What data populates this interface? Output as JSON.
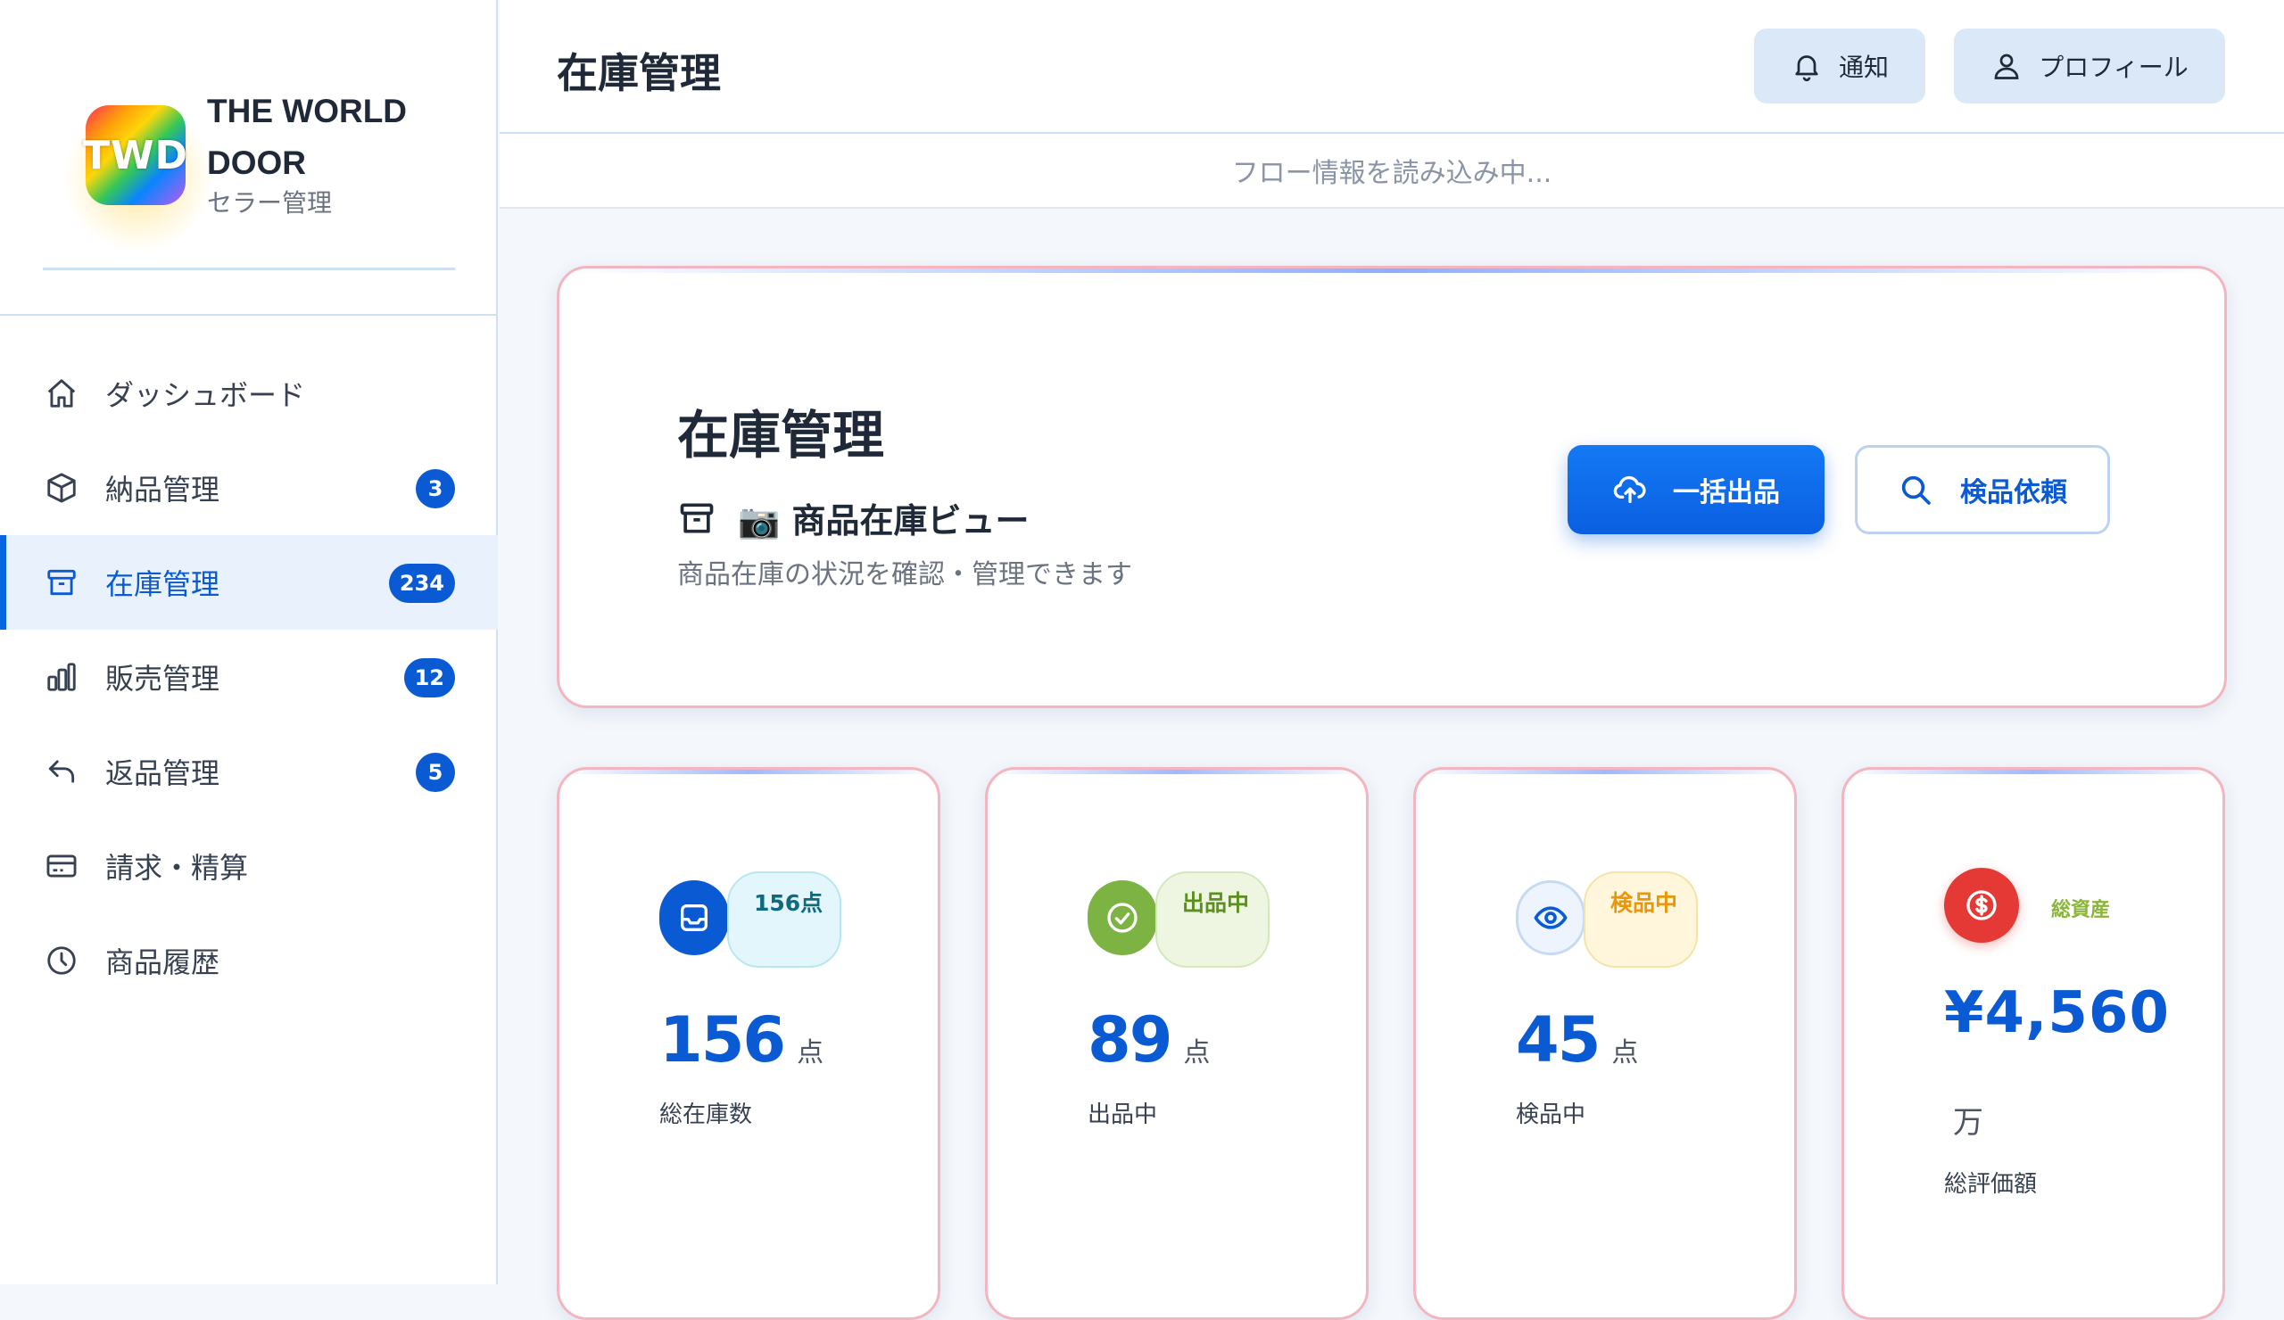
{
  "brand": {
    "logo_text": "TWD",
    "name": "THE WORLD DOOR",
    "subtitle": "セラー管理"
  },
  "sidebar": {
    "items": [
      {
        "label": "ダッシュボード",
        "icon": "home-icon",
        "badge": null,
        "active": false
      },
      {
        "label": "納品管理",
        "icon": "package-icon",
        "badge": "3",
        "active": false
      },
      {
        "label": "在庫管理",
        "icon": "archive-icon",
        "badge": "234",
        "active": true
      },
      {
        "label": "販売管理",
        "icon": "bar-chart-icon",
        "badge": "12",
        "active": false
      },
      {
        "label": "返品管理",
        "icon": "return-arrow-icon",
        "badge": "5",
        "active": false
      },
      {
        "label": "請求・精算",
        "icon": "credit-card-icon",
        "badge": null,
        "active": false
      },
      {
        "label": "商品履歴",
        "icon": "clock-icon",
        "badge": null,
        "active": false
      }
    ]
  },
  "header": {
    "title": "在庫管理",
    "notify_label": "通知",
    "profile_label": "プロフィール"
  },
  "flow_status": "フロー情報を読み込み中...",
  "hero": {
    "title": "在庫管理",
    "subtitle": "📷 商品在庫ビュー",
    "description": "商品在庫の状況を確認・管理できます",
    "primary_button": "一括出品",
    "secondary_button": "検品依頼"
  },
  "stats": [
    {
      "chip": "156点",
      "value": "156",
      "unit": "点",
      "label": "総在庫数",
      "icon": "inbox-icon",
      "color": "#0a5bd3"
    },
    {
      "chip": "出品中",
      "value": "89",
      "unit": "点",
      "label": "出品中",
      "icon": "check-circle-icon",
      "color": "#7cb342"
    },
    {
      "chip": "検品中",
      "value": "45",
      "unit": "点",
      "label": "検品中",
      "icon": "eye-icon",
      "color": "#f5a623"
    },
    {
      "chip": "総資産",
      "value": "¥4,560",
      "unit": "万",
      "label": "総評価額",
      "icon": "dollar-circle-icon",
      "color": "#e53935"
    }
  ],
  "colors": {
    "accent": "#0a5bd3",
    "card_border": "#f3b6c0",
    "sidebar_active_bg": "#e8f1fc"
  }
}
